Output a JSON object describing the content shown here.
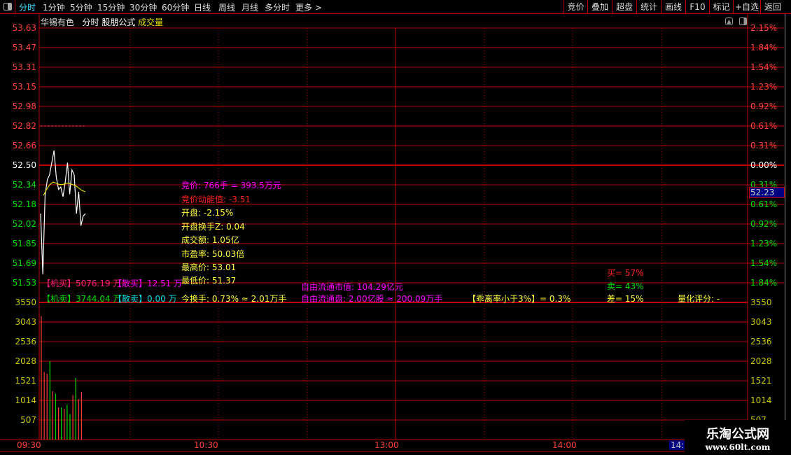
{
  "toolbar": {
    "tabs": [
      {
        "label": "分时",
        "active": true
      },
      {
        "label": "1分钟"
      },
      {
        "label": "5分钟"
      },
      {
        "label": "15分钟"
      },
      {
        "label": "30分钟"
      },
      {
        "label": "60分钟"
      },
      {
        "label": "日线"
      },
      {
        "label": "周线"
      },
      {
        "label": "月线"
      },
      {
        "label": "多分时"
      },
      {
        "label": "更多 >"
      }
    ],
    "right_buttons": [
      "竞价",
      "叠加",
      "超盘",
      "统计",
      "画线",
      "F10",
      "标记",
      "+自选",
      "返回"
    ]
  },
  "header": {
    "stock_name": "华锡有色",
    "mode": "分时",
    "formula": "股朋公式",
    "indicator": "成交量"
  },
  "price_axis": [
    "53.63",
    "53.47",
    "53.31",
    "53.15",
    "52.98",
    "52.82",
    "52.66",
    "52.50",
    "52.34",
    "52.18",
    "52.02",
    "51.85",
    "51.69",
    "51.53"
  ],
  "pct_axis": [
    "2.15%",
    "1.84%",
    "1.54%",
    "1.23%",
    "0.92%",
    "0.61%",
    "0.31%",
    "0.00%",
    "0.31%",
    "0.61%",
    "0.92%",
    "1.23%",
    "1.54%",
    "1.84%"
  ],
  "current_price": "52.23",
  "volume_axis": [
    "3550",
    "3043",
    "2536",
    "2028",
    "1521",
    "1014",
    "507"
  ],
  "time_axis": [
    "09:30",
    "10:30",
    "13:00",
    "14:00",
    "14:4"
  ],
  "info": {
    "auction": "竞价: 766手 = 393.5万元",
    "auction_energy": "竞价动能值: -3.51",
    "open": "开盘: -2.15%",
    "open_turnover": "开盘换手Z: 0.04",
    "amount": "成交额: 1.05亿",
    "pe": "市盈率: 50.03倍",
    "high": "最高价: 53.01",
    "low": "最低价: 51.37",
    "turnover": "今换手: 0.73% ≈ 2.01万手",
    "inst_buy": "【机买】5076.19 万",
    "retail_buy": "【散买】12.51 万",
    "inst_sell": "【机卖】3744.04 万",
    "retail_sell": "【散卖】0.00 万",
    "float_value": "自由流通市值: 104.29亿元",
    "float_shares": "自由流通盘: 2.00亿股 ≈ 200.09万手",
    "deviation": "【乖离率小于3%】= 0.3%",
    "buy_pct": "买= 57%",
    "sell_pct": "卖= 43%",
    "diff_pct": "差= 15%",
    "quant_score": "量化评分: -"
  },
  "price_series": [
    52.1,
    51.6,
    52.25,
    52.38,
    52.42,
    52.52,
    52.62,
    52.4,
    52.3,
    52.32,
    52.24,
    52.36,
    52.52,
    52.26,
    52.46,
    52.42,
    52.1,
    52.28,
    52.0,
    52.08,
    52.1
  ],
  "avg_series": [
    52.25,
    52.3,
    52.34,
    52.36,
    52.35,
    52.34,
    52.34,
    52.35,
    52.35,
    52.34,
    52.33,
    52.31,
    52.29,
    52.28
  ],
  "volume_bars": [
    {
      "v": 3200,
      "up": true
    },
    {
      "v": 1750,
      "up": true
    },
    {
      "v": 1700,
      "up": true
    },
    {
      "v": 2030,
      "up": false
    },
    {
      "v": 1250,
      "up": true
    },
    {
      "v": 1190,
      "up": false
    },
    {
      "v": 830,
      "up": true
    },
    {
      "v": 830,
      "up": false
    },
    {
      "v": 800,
      "up": true
    },
    {
      "v": 900,
      "up": false
    },
    {
      "v": 660,
      "up": false
    },
    {
      "v": 1150,
      "up": true
    },
    {
      "v": 1600,
      "up": false
    },
    {
      "v": 1050,
      "up": true
    },
    {
      "v": 1230,
      "up": true
    }
  ],
  "watermark": {
    "name": "乐淘公式网",
    "url": "www.60lt.com"
  },
  "colors": {
    "grid": "#c00000",
    "up": "#ff3c3c",
    "down": "#00e000",
    "axis_volume": "#c8c800",
    "current_bg": "#000080"
  }
}
